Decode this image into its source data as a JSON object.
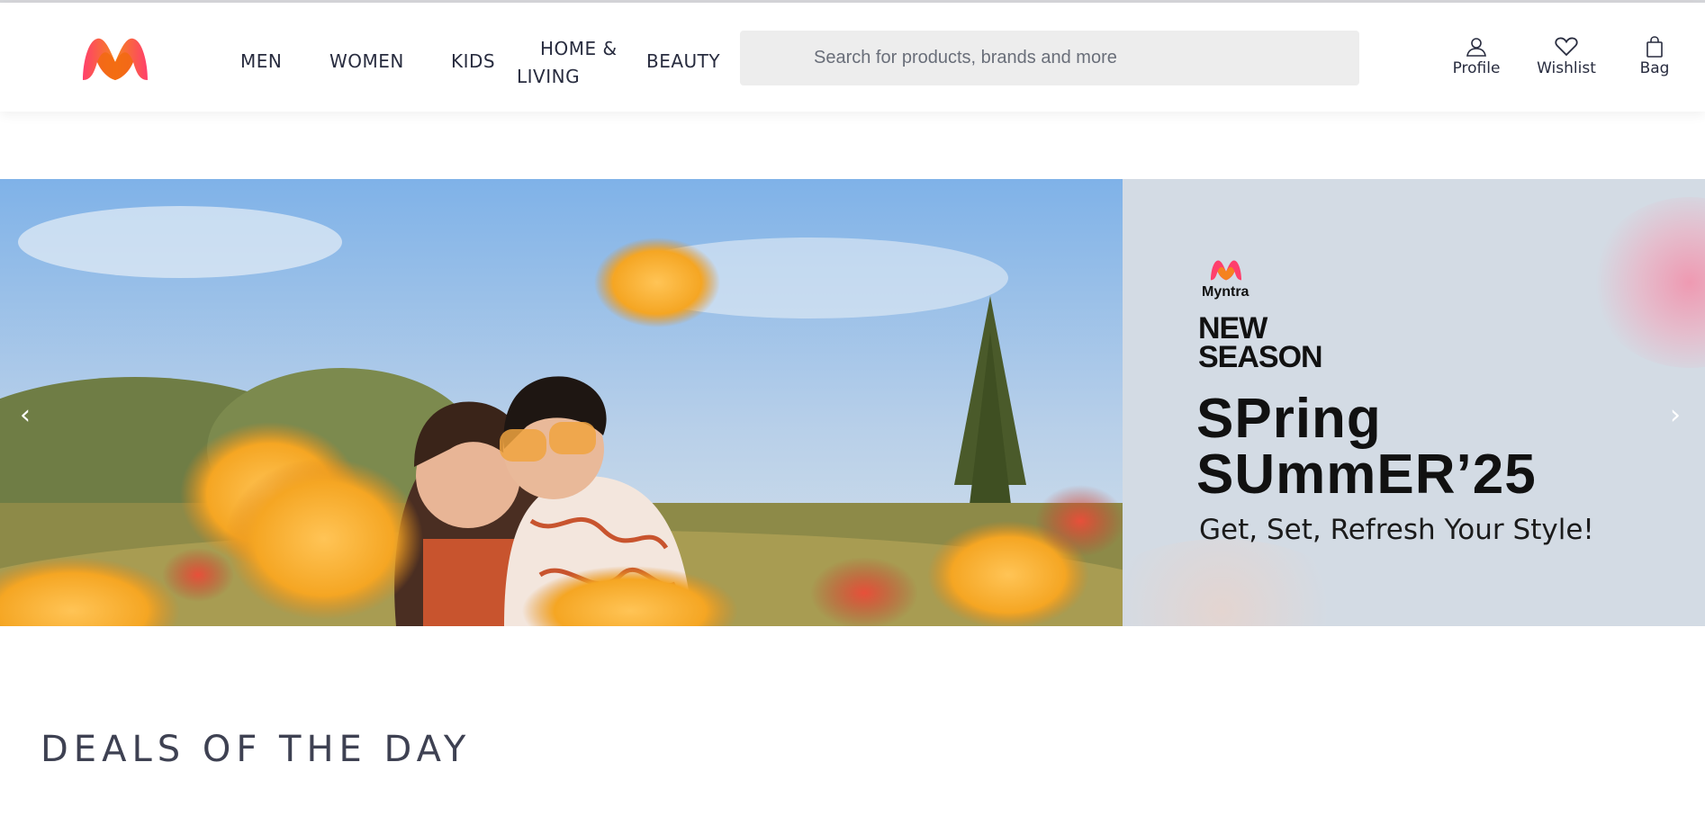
{
  "colors": {
    "brand_pink": "#ff3f6c",
    "brand_orange": "#f5821f",
    "text_dark": "#282c3f",
    "search_bg": "#ededed",
    "deals_title": "#3e4152"
  },
  "header": {
    "logo_icon": "myntra-logo-icon",
    "nav": [
      {
        "label": "MEN"
      },
      {
        "label": "WOMEN"
      },
      {
        "label": "KIDS"
      },
      {
        "label_line1": "HOME &",
        "label_line2": "LIVING"
      },
      {
        "label": "BEAUTY"
      }
    ],
    "search": {
      "placeholder": "Search for products, brands and more",
      "value": ""
    },
    "actions": [
      {
        "label": "Profile",
        "icon": "user-icon"
      },
      {
        "label": "Wishlist",
        "icon": "heart-icon"
      },
      {
        "label": "Bag",
        "icon": "bag-icon"
      }
    ]
  },
  "banner": {
    "brand": "Myntra",
    "headline_line1": "NEW",
    "headline_line2": "SEASON",
    "title_line1": "SPring",
    "title_line2": "SUmmER’25",
    "tagline": "Get, Set, Refresh Your Style!",
    "prev_arrow": "‹",
    "next_arrow": "›"
  },
  "deals": {
    "title": "DEALS OF THE DAY"
  }
}
